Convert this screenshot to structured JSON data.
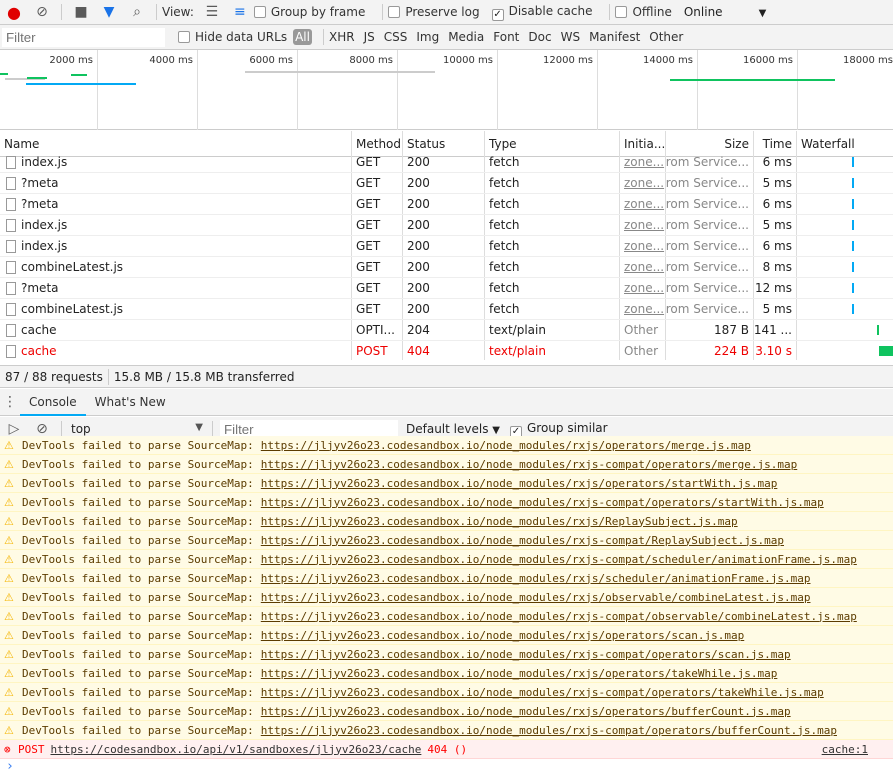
{
  "toolbar": {
    "view_label": "View:",
    "group_by_frame": "Group by frame",
    "preserve_log": "Preserve log",
    "disable_cache": "Disable cache",
    "offline": "Offline",
    "throttle": "Online"
  },
  "filterbar": {
    "placeholder": "Filter",
    "hide_data_urls": "Hide data URLs",
    "types": [
      "All",
      "XHR",
      "JS",
      "CSS",
      "Img",
      "Media",
      "Font",
      "Doc",
      "WS",
      "Manifest",
      "Other"
    ]
  },
  "overview": {
    "ticks": [
      "2000 ms",
      "4000 ms",
      "6000 ms",
      "8000 ms",
      "10000 ms",
      "12000 ms",
      "14000 ms",
      "16000 ms",
      "18000 ms"
    ]
  },
  "columns": [
    "Name",
    "Method",
    "Status",
    "Type",
    "Initia...",
    "Size",
    "Time",
    "Waterfall"
  ],
  "rows": [
    {
      "name": "index.js",
      "method": "GET",
      "status": "200",
      "type": "fetch",
      "initiator": "zone...",
      "size": "(from Service...",
      "time": "6 ms"
    },
    {
      "name": "?meta",
      "method": "GET",
      "status": "200",
      "type": "fetch",
      "initiator": "zone...",
      "size": "(from Service...",
      "time": "5 ms"
    },
    {
      "name": "?meta",
      "method": "GET",
      "status": "200",
      "type": "fetch",
      "initiator": "zone...",
      "size": "(from Service...",
      "time": "6 ms"
    },
    {
      "name": "index.js",
      "method": "GET",
      "status": "200",
      "type": "fetch",
      "initiator": "zone...",
      "size": "(from Service...",
      "time": "5 ms"
    },
    {
      "name": "index.js",
      "method": "GET",
      "status": "200",
      "type": "fetch",
      "initiator": "zone...",
      "size": "(from Service...",
      "time": "6 ms"
    },
    {
      "name": "combineLatest.js",
      "method": "GET",
      "status": "200",
      "type": "fetch",
      "initiator": "zone...",
      "size": "(from Service...",
      "time": "8 ms"
    },
    {
      "name": "?meta",
      "method": "GET",
      "status": "200",
      "type": "fetch",
      "initiator": "zone...",
      "size": "(from Service...",
      "time": "12 ms"
    },
    {
      "name": "combineLatest.js",
      "method": "GET",
      "status": "200",
      "type": "fetch",
      "initiator": "zone...",
      "size": "(from Service...",
      "time": "5 ms"
    },
    {
      "name": "cache",
      "method": "OPTI...",
      "status": "204",
      "type": "text/plain",
      "initiator": "Other",
      "size": "187 B",
      "time": "141 ..."
    },
    {
      "name": "cache",
      "method": "POST",
      "status": "404",
      "type": "text/plain",
      "initiator": "Other",
      "size": "224 B",
      "time": "3.10 s",
      "error": true
    }
  ],
  "status": {
    "requests": "87 / 88 requests",
    "transferred": "15.8 MB / 15.8 MB transferred"
  },
  "drawer": {
    "tabs": [
      "Console",
      "What's New"
    ],
    "context": "top",
    "filter_placeholder": "Filter",
    "levels": "Default levels",
    "group_similar": "Group similar"
  },
  "console": {
    "warning_prefix": "DevTools failed to parse SourceMap:",
    "warnings": [
      "https://jljyv26o23.codesandbox.io/node_modules/rxjs/operators/merge.js.map",
      "https://jljyv26o23.codesandbox.io/node_modules/rxjs-compat/operators/merge.js.map",
      "https://jljyv26o23.codesandbox.io/node_modules/rxjs/operators/startWith.js.map",
      "https://jljyv26o23.codesandbox.io/node_modules/rxjs-compat/operators/startWith.js.map",
      "https://jljyv26o23.codesandbox.io/node_modules/rxjs/ReplaySubject.js.map",
      "https://jljyv26o23.codesandbox.io/node_modules/rxjs-compat/ReplaySubject.js.map",
      "https://jljyv26o23.codesandbox.io/node_modules/rxjs-compat/scheduler/animationFrame.js.map",
      "https://jljyv26o23.codesandbox.io/node_modules/rxjs/scheduler/animationFrame.js.map",
      "https://jljyv26o23.codesandbox.io/node_modules/rxjs/observable/combineLatest.js.map",
      "https://jljyv26o23.codesandbox.io/node_modules/rxjs-compat/observable/combineLatest.js.map",
      "https://jljyv26o23.codesandbox.io/node_modules/rxjs/operators/scan.js.map",
      "https://jljyv26o23.codesandbox.io/node_modules/rxjs-compat/operators/scan.js.map",
      "https://jljyv26o23.codesandbox.io/node_modules/rxjs/operators/takeWhile.js.map",
      "https://jljyv26o23.codesandbox.io/node_modules/rxjs-compat/operators/takeWhile.js.map",
      "https://jljyv26o23.codesandbox.io/node_modules/rxjs/operators/bufferCount.js.map",
      "https://jljyv26o23.codesandbox.io/node_modules/rxjs-compat/operators/bufferCount.js.map"
    ],
    "error": {
      "method": "POST",
      "url": "https://codesandbox.io/api/v1/sandboxes/jljyv26o23/cache",
      "code": "404 ()",
      "source": "cache:1"
    }
  },
  "colors": {
    "record": "#e00000",
    "accent": "#03a9f4",
    "finish": "#0fc35f",
    "error": "#ff0000"
  }
}
